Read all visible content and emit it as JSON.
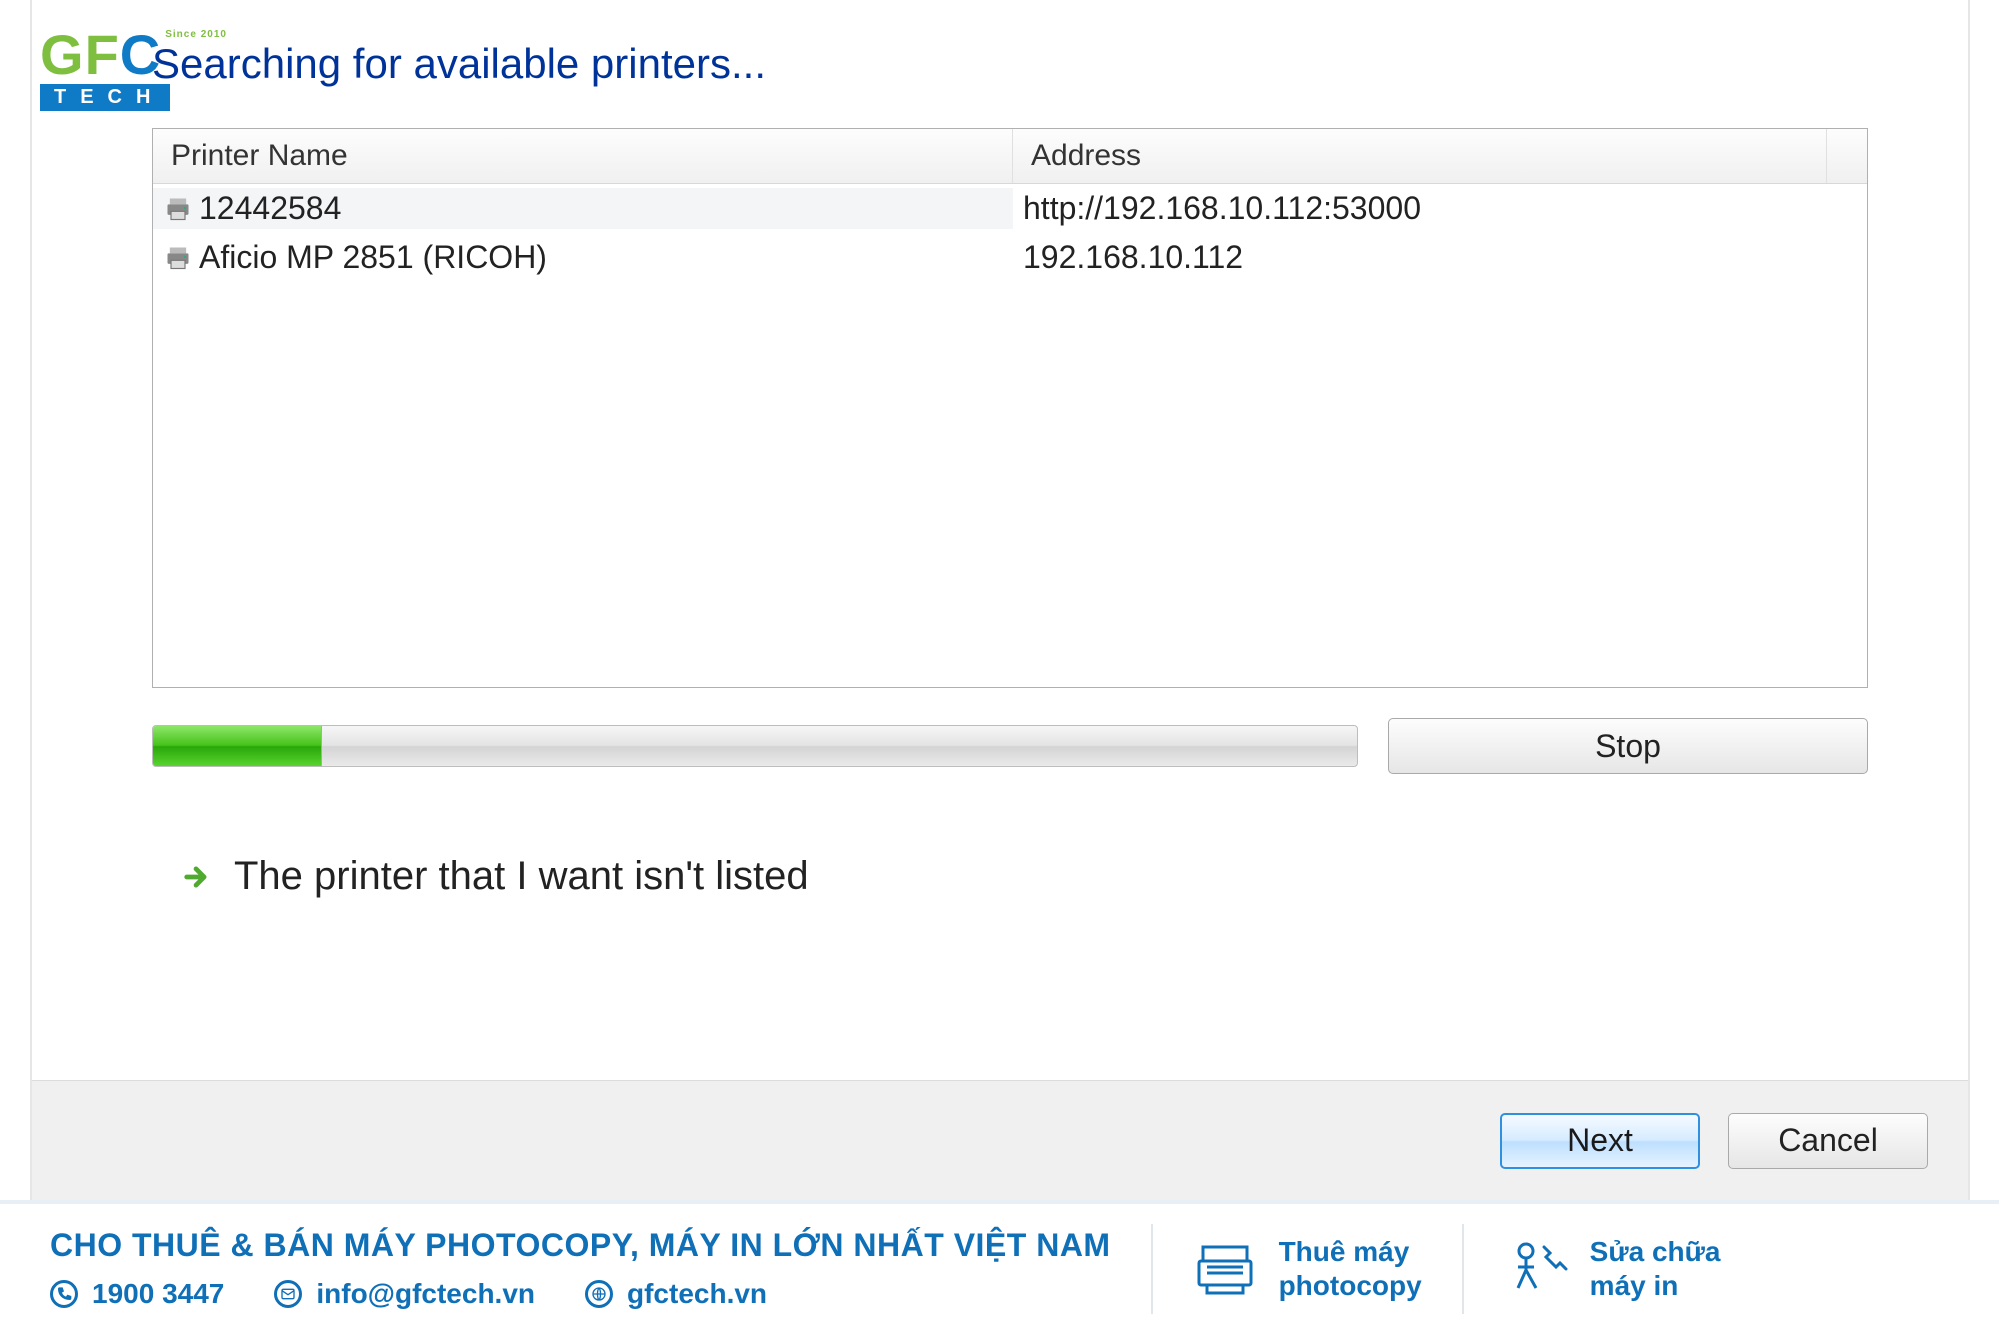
{
  "logo": {
    "brand_g": "G",
    "brand_f": "F",
    "brand_c": "C",
    "since": "Since 2010",
    "tech": "TECH"
  },
  "dialog": {
    "heading": "Searching for available printers...",
    "columns": {
      "name": "Printer Name",
      "address": "Address"
    },
    "rows": [
      {
        "name": "12442584",
        "address": "http://192.168.10.112:53000"
      },
      {
        "name": "Aficio MP 2851 (RICOH)",
        "address": "192.168.10.112"
      }
    ],
    "stop": "Stop",
    "not_listed": "The printer that I want isn't listed",
    "next": "Next",
    "cancel": "Cancel",
    "progress_percent": 14
  },
  "banner": {
    "title": "CHO THUÊ & BÁN MÁY PHOTOCOPY, MÁY IN LỚN NHẤT VIỆT NAM",
    "phone": "1900 3447",
    "email": "info@gfctech.vn",
    "site": "gfctech.vn",
    "svc1_l1": "Thuê máy",
    "svc1_l2": "photocopy",
    "svc2_l1": "Sửa chữa",
    "svc2_l2": "máy in"
  }
}
